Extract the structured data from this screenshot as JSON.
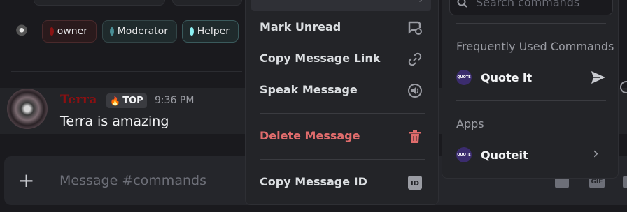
{
  "roles": [
    {
      "label": "owner",
      "color": "#8b1414"
    },
    {
      "label": "Moderator",
      "color": "#4a8f96"
    },
    {
      "label": "Helper",
      "color": "#8bf0f2"
    }
  ],
  "message": {
    "author": "Terra",
    "badge": "TOP",
    "timestamp": "9:36 PM",
    "text": "Terra is amazing"
  },
  "composer": {
    "placeholder": "Message #commands",
    "gif_label": "GIF"
  },
  "context_menu": {
    "items": [
      {
        "label": "Mark Unread",
        "icon": "mark-unread-icon"
      },
      {
        "label": "Copy Message Link",
        "icon": "link-icon"
      },
      {
        "label": "Speak Message",
        "icon": "speaker-icon"
      },
      {
        "label": "Delete Message",
        "icon": "trash-icon",
        "danger": true
      },
      {
        "label": "Copy Message ID",
        "icon": "id-icon"
      }
    ]
  },
  "commands_panel": {
    "search_placeholder": "Search commands",
    "frequent_heading": "Frequently Used Commands",
    "frequent": [
      {
        "label": "Quote it"
      }
    ],
    "apps_heading": "Apps",
    "apps": [
      {
        "label": "Quoteit"
      }
    ],
    "avatar_text": "QUOTE"
  },
  "colors": {
    "danger": "#e06c6c",
    "username": "#8a1012",
    "background": "#1a1a1e"
  }
}
